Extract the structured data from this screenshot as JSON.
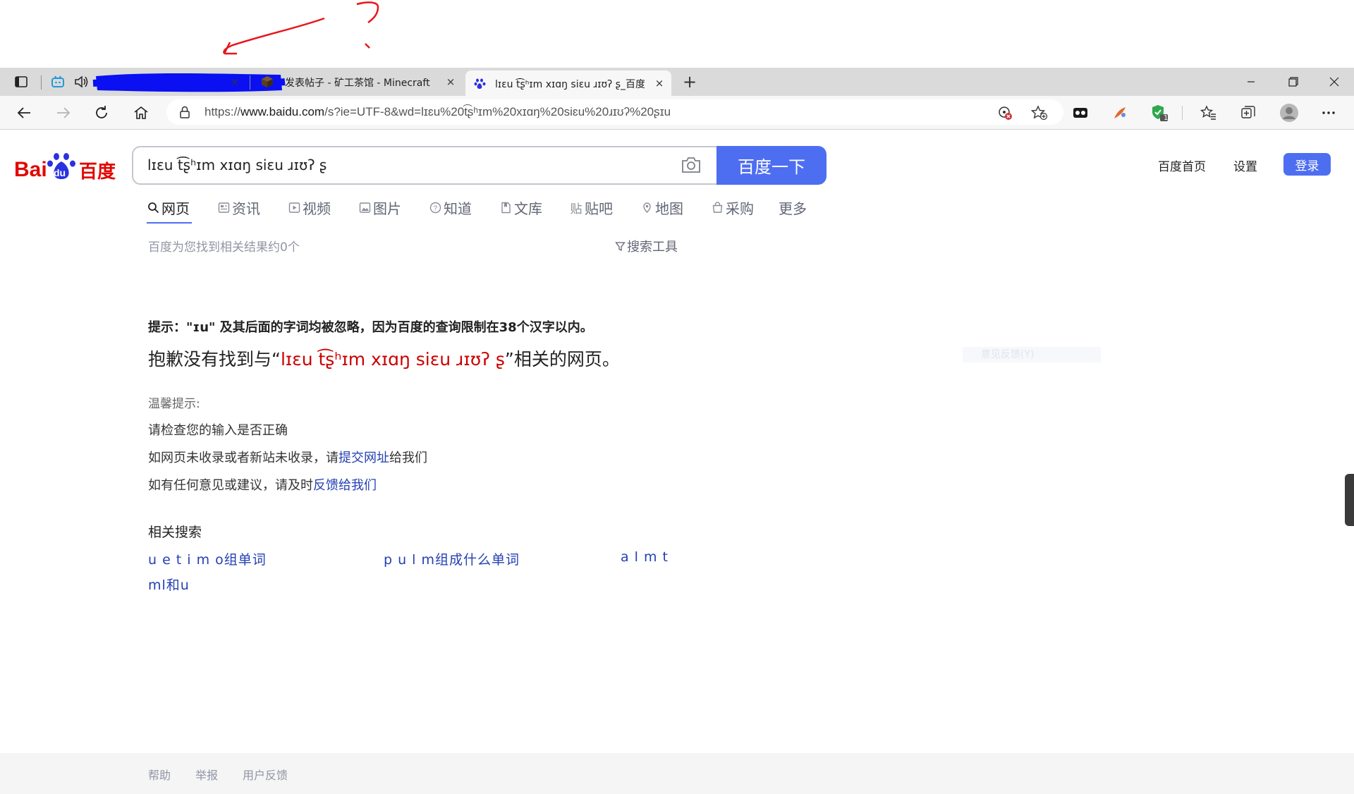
{
  "browser": {
    "tabs": [
      {
        "title": "",
        "icons": [
          "bilibili-icon",
          "speaker-icon"
        ],
        "redacted": true,
        "close": "×"
      },
      {
        "title": "发表帖子 - 矿工茶馆 - Minecraft",
        "icons": [
          "minecraft-block-icon"
        ],
        "close": "×"
      },
      {
        "title": "lɪɛu t͡ʂʰɪm xɪɑŋ siɛu ɹɪʊʔ ʂ_百度搜",
        "icons": [
          "baidu-paw-icon"
        ],
        "active": true,
        "close": "×"
      }
    ],
    "new_tab": "+",
    "window": {
      "minimize": "—",
      "restore": "❐",
      "close": "✕"
    },
    "address": {
      "scheme": "https://",
      "host": "www.baidu.com",
      "path": "/s?ie=UTF-8&wd=lɪɛu%20t͡ʂʰɪm%20xɪɑŋ%20siɛu%20ɹɪʊʔ%20ʂɪu"
    },
    "extension_badge": "1"
  },
  "baidu": {
    "query": "lɪɛu t͡ʂʰɪm xɪɑŋ siɛu ɹɪʊʔ ʂ",
    "submit": "百度一下",
    "top_links": {
      "home": "百度首页",
      "settings": "设置",
      "login": "登录"
    },
    "nav": [
      {
        "label": "网页",
        "icon": "search-icon"
      },
      {
        "label": "资讯",
        "icon": "news-icon"
      },
      {
        "label": "视频",
        "icon": "video-icon"
      },
      {
        "label": "图片",
        "icon": "image-icon"
      },
      {
        "label": "知道",
        "icon": "question-icon"
      },
      {
        "label": "文库",
        "icon": "document-icon"
      },
      {
        "label": "贴吧",
        "icon": "tieba-icon"
      },
      {
        "label": "地图",
        "icon": "map-icon"
      },
      {
        "label": "采购",
        "icon": "shopping-icon"
      },
      {
        "label": "更多",
        "icon": ""
      }
    ],
    "result_count": "百度为您找到相关结果约0个",
    "search_tools": "搜索工具",
    "hint": "提示：\"ɪu\" 及其后面的字词均被忽略，因为百度的查询限制在38个汉字以内。",
    "sorry_prefix": "抱歉没有找到与",
    "sorry_open_quote": "“",
    "sorry_query": "lɪɛu t͡ʂʰɪm xɪɑŋ siɛu ɹɪʊʔ ʂ",
    "sorry_close_quote": "”",
    "sorry_suffix": "相关的网页。",
    "faint_feedback": "意见反馈(Y)",
    "tips": {
      "title": "温馨提示:",
      "line1": "请检查您的输入是否正确",
      "line2_prefix": "如网页未收录或者新站未收录，请",
      "line2_link": "提交网址",
      "line2_suffix": "给我们",
      "line3_prefix": "如有任何意见或建议，请及时",
      "line3_link": "反馈给我们"
    },
    "related_title": "相关搜索",
    "related": [
      "u e t i m o组单词",
      "p u l m组成什么单词",
      "a l m t",
      "ml和u"
    ],
    "footer": [
      "帮助",
      "举报",
      "用户反馈"
    ]
  },
  "colors": {
    "baidu_blue": "#4e6ef2",
    "link_blue": "#2440b3",
    "highlight_red": "#cc0000",
    "annotation_red": "#e8151b",
    "redaction_blue": "#0a10f2"
  }
}
